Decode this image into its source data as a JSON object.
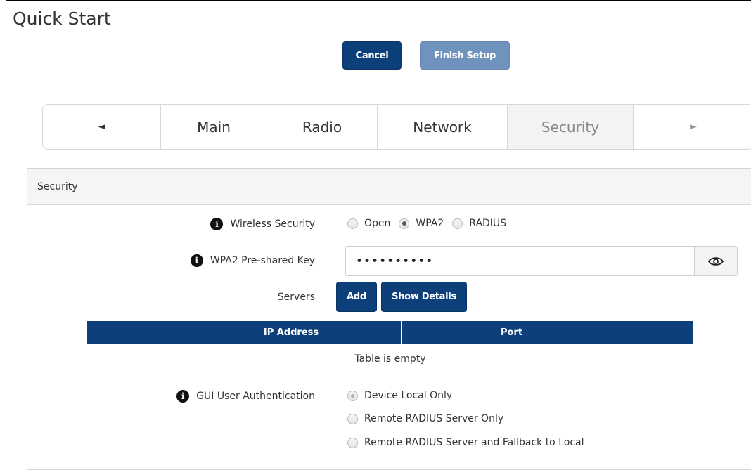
{
  "page": {
    "title": "Quick Start"
  },
  "toolbar": {
    "cancel_label": "Cancel",
    "finish_label": "Finish Setup"
  },
  "tabs": {
    "prev_arrow": "◄",
    "next_arrow": "►",
    "items": [
      {
        "label": "Main"
      },
      {
        "label": "Radio"
      },
      {
        "label": "Network"
      },
      {
        "label": "Security",
        "active": true
      }
    ]
  },
  "panel": {
    "header": "Security",
    "wireless_security": {
      "label": "Wireless Security",
      "options": [
        "Open",
        "WPA2",
        "RADIUS"
      ],
      "selected": "WPA2"
    },
    "psk": {
      "label": "WPA2 Pre-shared Key",
      "value": "••••••••••",
      "reveal_icon": "eye-icon"
    },
    "servers": {
      "label": "Servers",
      "add_label": "Add",
      "details_label": "Show Details",
      "columns": [
        "",
        "IP Address",
        "Port",
        ""
      ],
      "empty_text": "Table is empty"
    },
    "gui_auth": {
      "label": "GUI User Authentication",
      "options": [
        "Device Local Only",
        "Remote RADIUS Server Only",
        "Remote RADIUS Server and Fallback to Local"
      ],
      "selected": "Device Local Only"
    }
  },
  "colors": {
    "primary": "#0d3f7a",
    "disabled_primary": "#6f93bd",
    "active_tab_bg": "#f3f3f3"
  }
}
